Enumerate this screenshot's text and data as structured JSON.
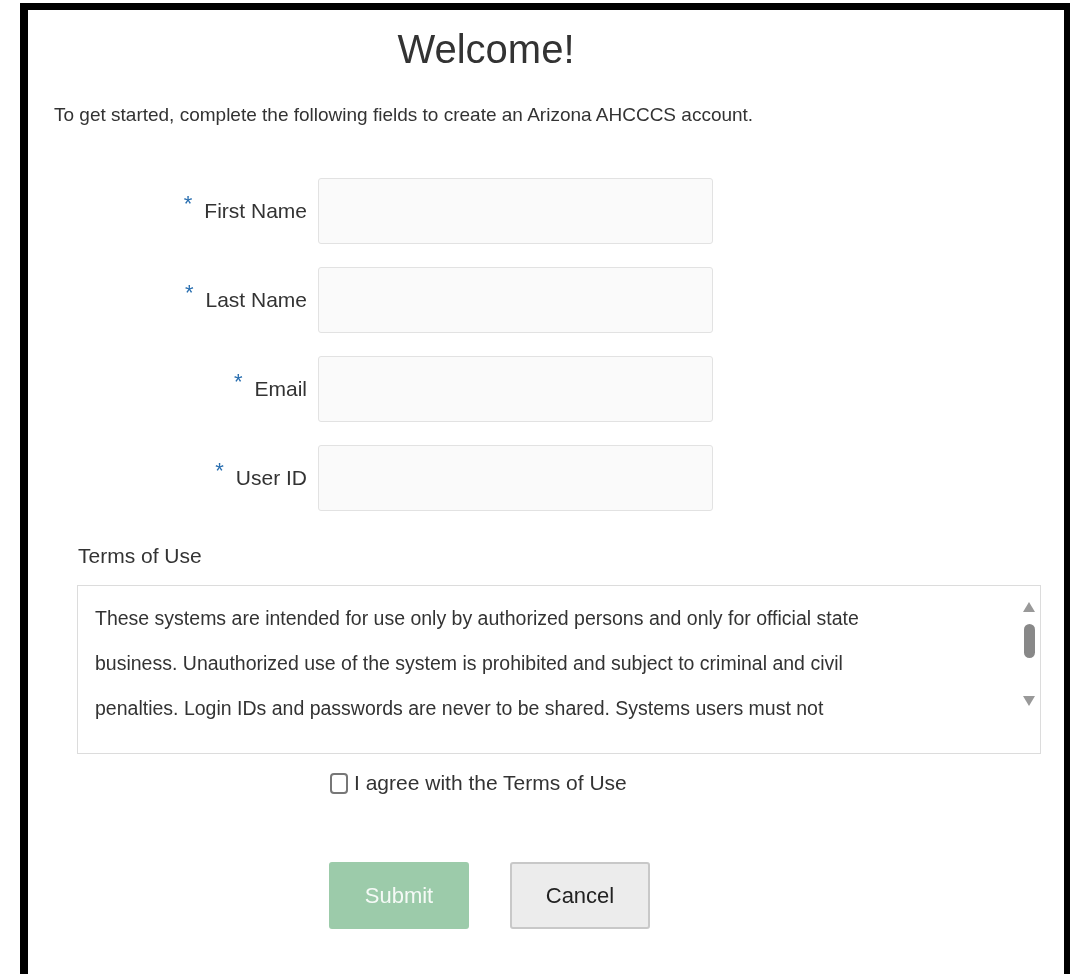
{
  "title": "Welcome!",
  "intro": "To get started, complete the following fields to create an Arizona AHCCCS account.",
  "fields": [
    {
      "label": "First Name",
      "required": true
    },
    {
      "label": "Last Name",
      "required": true
    },
    {
      "label": "Email",
      "required": true
    },
    {
      "label": "User ID",
      "required": true
    }
  ],
  "required_mark": "*",
  "terms": {
    "label": "Terms of Use",
    "lines": [
      "These systems are intended for use only by authorized persons and only for official state",
      "business. Unauthorized use of the system is prohibited and subject to criminal and civil",
      "penalties. Login IDs and passwords are never to be shared. Systems users must not"
    ]
  },
  "agree": {
    "label": "I agree with the Terms of Use",
    "checked": false
  },
  "buttons": [
    {
      "label": "Submit",
      "kind": "primary",
      "disabled": true
    },
    {
      "label": "Cancel",
      "kind": "secondary",
      "disabled": false
    }
  ]
}
